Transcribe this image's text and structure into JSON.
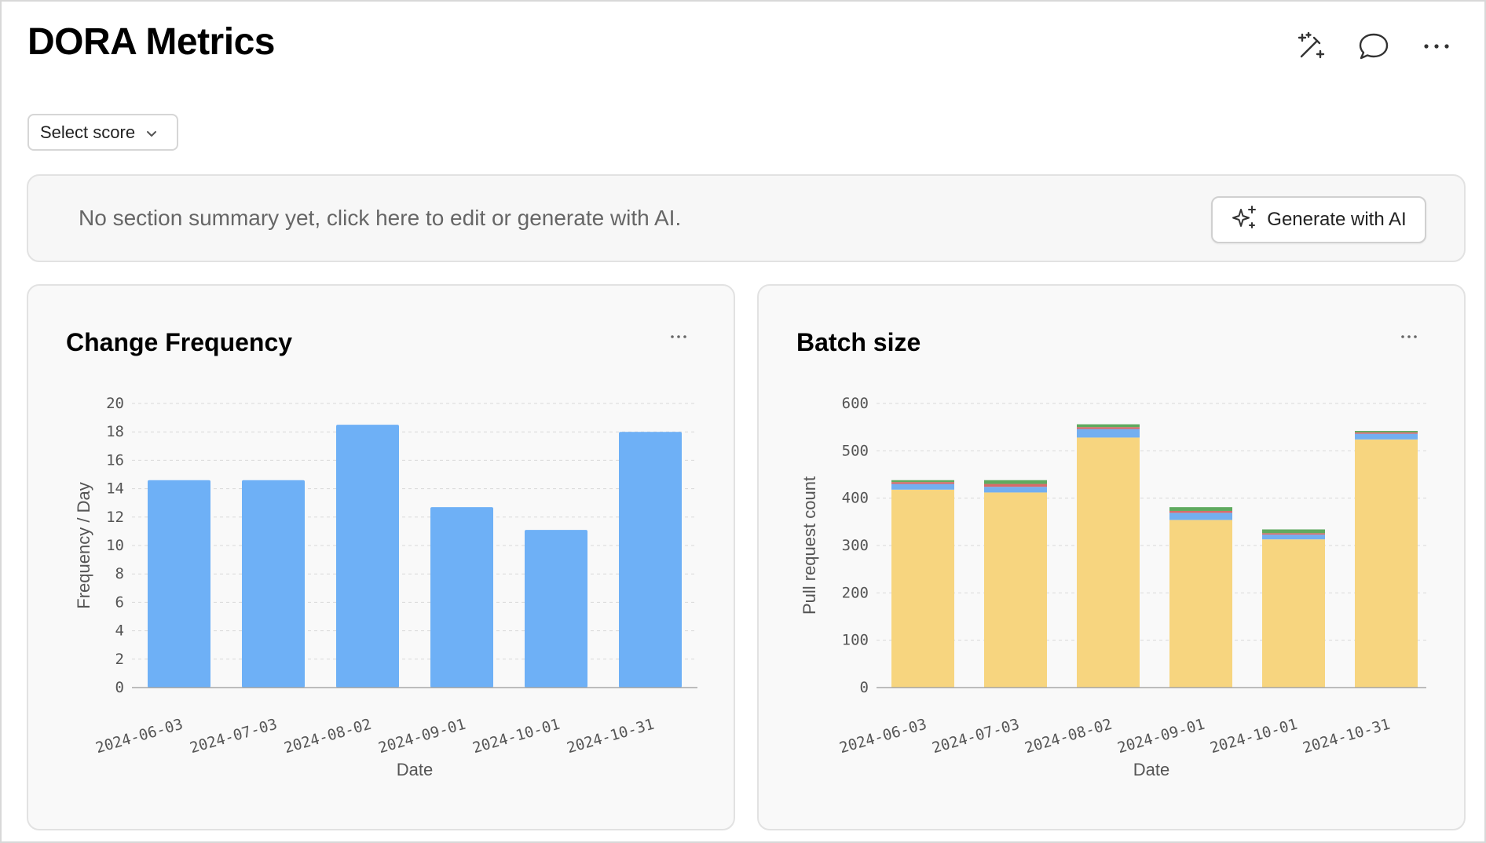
{
  "page": {
    "title": "DORA Metrics"
  },
  "toolbar": {
    "magic_icon": "magic-wand-icon",
    "comment_icon": "comment-icon",
    "more_icon": "more-horizontal-icon"
  },
  "filter": {
    "select_label": "Select score"
  },
  "summary": {
    "text": "No section summary yet, click here to edit or generate with AI.",
    "generate_label": "Generate with AI"
  },
  "colors": {
    "blue_bar": "#6eb0f6",
    "yellow": "#f7d57f",
    "blue_seg": "#73aff0",
    "red_seg": "#d96a6a",
    "green_seg": "#5faa5f",
    "grid": "#d9d9d9"
  },
  "chart_data": [
    {
      "type": "bar",
      "title": "Change Frequency",
      "categories": [
        "2024-06-03",
        "2024-07-03",
        "2024-08-02",
        "2024-09-01",
        "2024-10-01",
        "2024-10-31"
      ],
      "values": [
        14.6,
        14.6,
        18.5,
        12.7,
        11.1,
        18.0
      ],
      "xlabel": "Date",
      "ylabel": "Frequency / Day",
      "ylim": [
        0,
        20
      ],
      "yticks": [
        0,
        2,
        4,
        6,
        8,
        10,
        12,
        14,
        16,
        18,
        20
      ],
      "grid": true
    },
    {
      "type": "bar",
      "stacked": true,
      "title": "Batch size",
      "categories": [
        "2024-06-03",
        "2024-07-03",
        "2024-08-02",
        "2024-09-01",
        "2024-10-01",
        "2024-10-31"
      ],
      "series": [
        {
          "values": [
            418,
            412,
            528,
            354,
            313,
            524
          ],
          "color": "#f7d57f"
        },
        {
          "values": [
            12,
            12,
            18,
            15,
            10,
            12
          ],
          "color": "#73aff0"
        },
        {
          "values": [
            4,
            6,
            4,
            4,
            3,
            3
          ],
          "color": "#d96a6a"
        },
        {
          "values": [
            4,
            8,
            6,
            8,
            8,
            3
          ],
          "color": "#5faa5f"
        }
      ],
      "xlabel": "Date",
      "ylabel": "Pull request count",
      "ylim": [
        0,
        600
      ],
      "yticks": [
        0,
        100,
        200,
        300,
        400,
        500,
        600
      ],
      "grid": true
    }
  ]
}
